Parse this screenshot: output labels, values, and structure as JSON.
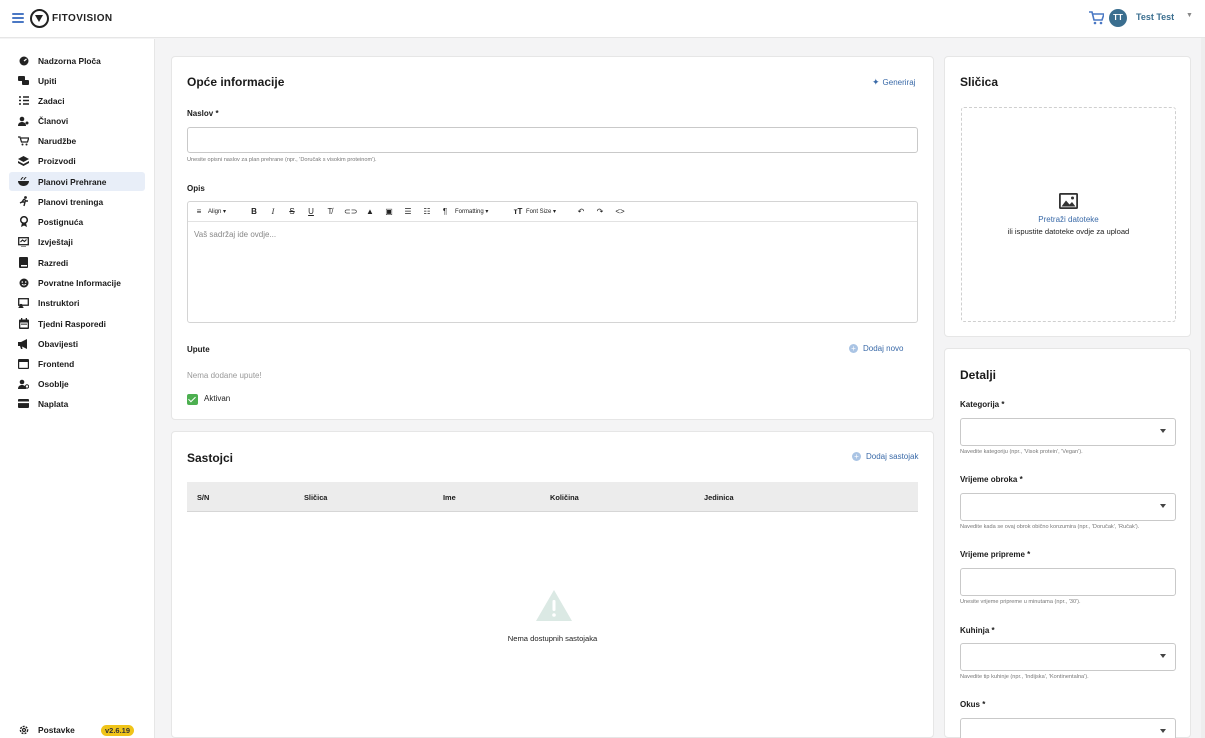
{
  "header": {
    "brand": "FITOVISION",
    "user_initials": "TT",
    "user_name": "Test Test"
  },
  "sidebar": {
    "items": [
      {
        "label": "Nadzorna Ploča",
        "icon": "dashboard-icon"
      },
      {
        "label": "Upiti",
        "icon": "chat-icon"
      },
      {
        "label": "Zadaci",
        "icon": "checklist-icon"
      },
      {
        "label": "Članovi",
        "icon": "members-icon"
      },
      {
        "label": "Narudžbe",
        "icon": "cart-icon"
      },
      {
        "label": "Proizvodi",
        "icon": "products-icon"
      },
      {
        "label": "Planovi Prehrane",
        "icon": "bowl-icon",
        "active": true
      },
      {
        "label": "Planovi treninga",
        "icon": "running-icon"
      },
      {
        "label": "Postignuća",
        "icon": "medal-icon"
      },
      {
        "label": "Izvještaji",
        "icon": "report-icon"
      },
      {
        "label": "Razredi",
        "icon": "book-icon"
      },
      {
        "label": "Povratne Informacije",
        "icon": "smiley-icon"
      },
      {
        "label": "Instruktori",
        "icon": "instructor-icon"
      },
      {
        "label": "Tjedni Rasporedi",
        "icon": "calendar-icon"
      },
      {
        "label": "Obavijesti",
        "icon": "megaphone-icon"
      },
      {
        "label": "Frontend",
        "icon": "browser-icon"
      },
      {
        "label": "Osoblje",
        "icon": "staff-icon"
      },
      {
        "label": "Naplata",
        "icon": "card-icon"
      }
    ],
    "settings_label": "Postavke",
    "version": "v2.6.19"
  },
  "general": {
    "title": "Opće informacije",
    "generate_label": "Generiraj",
    "title_label": "Naslov *",
    "title_hint": "Unesite opisni naslov za plan prehrane (npr., 'Doručak s visokim proteinom').",
    "description_label": "Opis",
    "toolbar": {
      "align": "Align",
      "formatting": "Formatting",
      "font_size": "Font Size"
    },
    "editor_placeholder": "Vaš sadržaj ide ovdje...",
    "instructions_label": "Upute",
    "add_new_label": "Dodaj novo",
    "no_instructions": "Nema dodane upute!",
    "active_label": "Aktivan"
  },
  "ingredients": {
    "title": "Sastojci",
    "add_label": "Dodaj sastojak",
    "columns": [
      "S/N",
      "Sličica",
      "Ime",
      "Količina",
      "Jedinica"
    ],
    "empty_text": "Nema dostupnih sastojaka"
  },
  "thumbnail": {
    "title": "Sličica",
    "browse_label": "Pretraži datoteke",
    "drop_label": "ili ispustite datoteke ovdje za upload"
  },
  "details": {
    "title": "Detalji",
    "category_label": "Kategorija *",
    "category_hint": "Navedite kategoriju (npr., 'Visok protein', 'Vegan').",
    "meal_time_label": "Vrijeme obroka *",
    "meal_time_hint": "Navedite kada se ovaj obrok obično konzumira (npr., 'Doručak', 'Ručak').",
    "prep_time_label": "Vrijeme pripreme *",
    "prep_time_hint": "Unesite vrijeme pripreme u minutama (npr., '30').",
    "cuisine_label": "Kuhinja *",
    "cuisine_hint": "Navedite tip kuhinje (npr., 'Indijska', 'Kontinentalna').",
    "taste_label": "Okus *"
  },
  "colors": {
    "accent": "#3a6aa8",
    "active_bg": "#e8eef8",
    "version_badge": "#f0c419",
    "checkbox": "#4caf50"
  }
}
